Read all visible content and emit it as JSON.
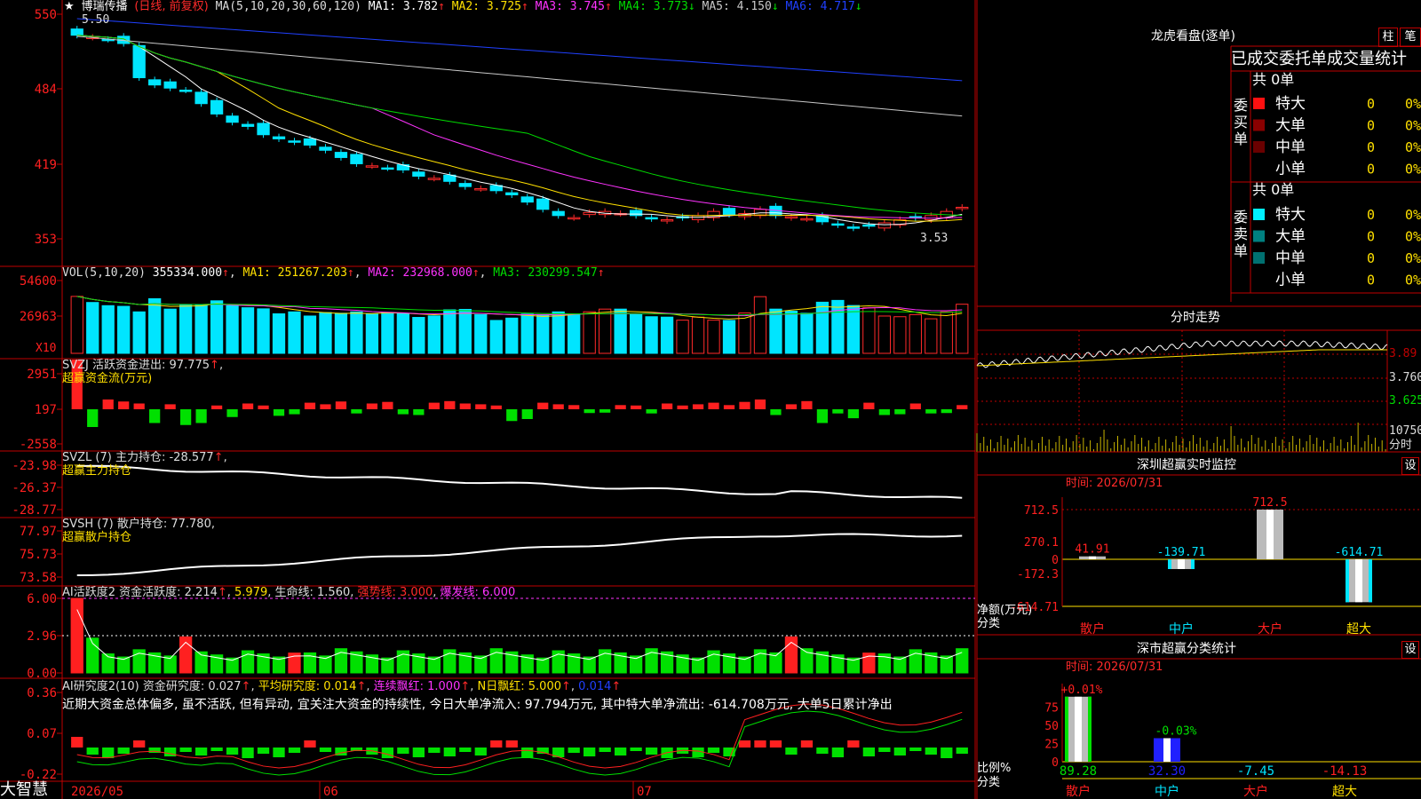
{
  "colors": {
    "up": "#ff2a2a",
    "down": "#00e5ff",
    "ma1": "#ffffff",
    "ma2": "#ffe000",
    "ma3": "#ff33ff",
    "ma4": "#00dd00",
    "ma5": "#c8c8c8",
    "ma6": "#2040ff",
    "green": "#00e000",
    "red": "#ff2020",
    "grid": "#c00000"
  },
  "header": {
    "star": "★",
    "stock": "博瑞传播",
    "period": "(日线, 前复权)",
    "ma_label": "MA(5,10,20,30,60,120)",
    "ma1": "MA1: 3.782",
    "ma2": "MA2: 3.725",
    "ma3": "MA3: 3.745",
    "ma4": "MA4: 3.773",
    "ma5": "MA5: 4.150",
    "ma6": "MA6: 4.717",
    "arrow_up": "↑",
    "arrow_down": "↓"
  },
  "price_panel": {
    "y_ticks": [
      "550",
      "484",
      "419",
      "353"
    ],
    "high_label": "5.50",
    "low_label": "3.53"
  },
  "vol_panel": {
    "label": "VOL(5,10,20)",
    "val": "355334.000",
    "ma1": "MA1: 251267.203",
    "ma2": "MA2: 232968.000",
    "ma3": "MA3: 230299.547",
    "y_ticks": [
      "54600",
      "26963"
    ],
    "unit": "X10"
  },
  "svzj": {
    "label": "SVZJ  活跃资金进出: 97.775",
    "sub": "超赢资金流(万元)",
    "y_ticks": [
      "2951",
      "197",
      "-2558"
    ]
  },
  "svzl": {
    "label": "SVZL (7) 主力持仓: -28.577",
    "sub": "超赢主力持仓",
    "y_ticks": [
      "-23.98",
      "-26.37",
      "-28.77"
    ]
  },
  "svsh": {
    "label": "SVSH (7) 散户持仓: 77.780",
    "sub": "超赢散户持仓",
    "y_ticks": [
      "77.97",
      "75.73",
      "73.58"
    ]
  },
  "ai1": {
    "label": "AI活跃度2 资金活跃度: 2.214",
    "v2": "5.979",
    "v3": "生命线: 1.560",
    "v4": "强势线: 3.000",
    "v5": "爆发线: 6.000",
    "y_ticks": [
      "6.00",
      "2.96",
      "0.00"
    ]
  },
  "ai2": {
    "label": "AI研究度2(10) 资金研究度: 0.027",
    "v2": "平均研究度: 0.014",
    "v3": "连续飘红: 1.000",
    "v4": "N日飘红: 5.000",
    "v5": "0.014",
    "y_ticks": [
      "0.36",
      "0.07",
      "-0.22"
    ],
    "comment": "近期大资金总体偏多, 虽不活跃, 但有异动, 宜关注大资金的持续性, 今日大单净流入: 97.794万元, 其中特大单净流出: -614.708万元, 大单5日累计净出"
  },
  "x_axis": {
    "brand": "大智慧",
    "labels": [
      "2026/05",
      "06",
      "07"
    ]
  },
  "right": {
    "lhb_title": "龙虎看盘(逐单)",
    "btn_col": "柱",
    "btn_pen": "笔",
    "tabs": "已成交委托单成交量统计",
    "buy": {
      "side": "委买单",
      "total": "共 0单",
      "rows": [
        {
          "name": "特大",
          "n": "0",
          "p": "0%"
        },
        {
          "name": "大单",
          "n": "0",
          "p": "0%"
        },
        {
          "name": "中单",
          "n": "0",
          "p": "0%"
        },
        {
          "name": "小单",
          "n": "0",
          "p": "0%"
        }
      ]
    },
    "sell": {
      "side": "委卖单",
      "total": "共 0单",
      "rows": [
        {
          "name": "特大",
          "n": "0",
          "p": "0%"
        },
        {
          "name": "大单",
          "n": "0",
          "p": "0%"
        },
        {
          "name": "中单",
          "n": "0",
          "p": "0%"
        },
        {
          "name": "小单",
          "n": "0",
          "p": "0%"
        }
      ]
    },
    "intraday": {
      "title": "分时走势",
      "p1": "3.89",
      "p2": "3.760",
      "p3": "3.625",
      "vol": "10750",
      "unit": "分时"
    },
    "sz_monitor": {
      "title": "深圳超赢实时监控",
      "btn": "设",
      "time": "时间: 2026/07/31",
      "y_ticks": [
        "712.5",
        "270.1",
        "0",
        "-172.3",
        "-614.71"
      ],
      "ylabel1": "净额(万元)",
      "ylabel2": "分类",
      "bars": [
        {
          "cat": "散户",
          "v": 41.91,
          "label": "41.91"
        },
        {
          "cat": "中户",
          "v": -139.71,
          "label": "-139.71"
        },
        {
          "cat": "大户",
          "v": 712.5,
          "label": "712.5"
        },
        {
          "cat": "超大",
          "v": -614.71,
          "label": "-614.71"
        }
      ]
    },
    "sz_class": {
      "title": "深市超赢分类统计",
      "btn": "设",
      "time": "时间: 2026/07/31",
      "y_ticks": [
        "75",
        "50",
        "25",
        "0"
      ],
      "ylabel1": "比例%",
      "ylabel2": "分类",
      "bars": [
        {
          "cat": "散户",
          "v": 89.28,
          "top": "+0.01%",
          "bottom": "89.28"
        },
        {
          "cat": "中户",
          "v": 32.3,
          "top": "-0.03%",
          "bottom": "32.30"
        },
        {
          "cat": "大户",
          "v": 0,
          "top": "",
          "bottom": "-7.45"
        },
        {
          "cat": "超大",
          "v": 0,
          "top": "",
          "bottom": "-14.13"
        }
      ]
    }
  },
  "chart_data": [
    {
      "type": "line",
      "title": "博瑞传播 (日线, 前复权)",
      "candles_note": "daily candlesticks",
      "x": [
        "2026/05",
        "06",
        "07"
      ],
      "ylim": [
        3.53,
        5.5
      ],
      "series": [
        {
          "name": "close",
          "values": [
            5.46,
            5.44,
            5.42,
            5.38,
            5.05,
            4.98,
            4.95,
            4.93,
            4.8,
            4.7,
            4.62,
            4.58,
            4.5,
            4.46,
            4.43,
            4.4,
            4.35,
            4.28,
            4.22,
            4.2,
            4.18,
            4.16,
            4.1,
            4.08,
            4.05,
            4.0,
            3.98,
            3.96,
            3.92,
            3.85,
            3.78,
            3.72,
            3.7,
            3.75,
            3.76,
            3.74,
            3.72,
            3.69,
            3.68,
            3.7,
            3.72,
            3.76,
            3.73,
            3.74,
            3.78,
            3.72,
            3.71,
            3.69,
            3.66,
            3.63,
            3.6,
            3.62,
            3.65,
            3.68,
            3.7,
            3.72,
            3.76,
            3.8
          ]
        }
      ]
    },
    {
      "type": "bar",
      "title": "VOL(5,10,20)",
      "series": [
        {
          "name": "VOL",
          "values": [
            412000,
            368000,
            345000,
            340000,
            300000,
            395000,
            320000,
            352000,
            350000,
            380000,
            344000,
            330000,
            322000,
            286000,
            300000,
            270000,
            295000,
            290000,
            300000,
            284000,
            296000,
            286000,
            260000,
            271000,
            315000,
            318000,
            280000,
            238000,
            255000,
            284000,
            280000,
            300000,
            285000,
            301000,
            320000,
            320000,
            280000,
            265000,
            262000,
            240000,
            262000,
            240000,
            238000,
            292000,
            410000,
            320000,
            305000,
            290000,
            370000,
            383000,
            346000,
            330000,
            270000,
            265000,
            280000,
            250000,
            300000,
            355334
          ]
        }
      ]
    },
    {
      "type": "bar",
      "title": "SVZJ 活跃资金进出",
      "series": [
        {
          "name": "活跃资金进出",
          "values": []
        }
      ]
    },
    {
      "type": "line",
      "title": "SVZL 主力持仓",
      "ylim": [
        -28.77,
        -23.98
      ],
      "series": [
        {
          "name": "主力持仓",
          "values": []
        }
      ]
    },
    {
      "type": "line",
      "title": "SVSH 散户持仓",
      "ylim": [
        73.58,
        77.97
      ],
      "series": [
        {
          "name": "散户持仓",
          "values": []
        }
      ]
    },
    {
      "type": "bar",
      "title": "AI活跃度2",
      "ylim": [
        0,
        6
      ],
      "series": [
        {
          "name": "资金活跃度",
          "values": []
        }
      ]
    },
    {
      "type": "bar",
      "title": "AI研究度2(10)",
      "ylim": [
        -0.22,
        0.36
      ],
      "series": [
        {
          "name": "资金研究度",
          "values": []
        }
      ]
    }
  ]
}
